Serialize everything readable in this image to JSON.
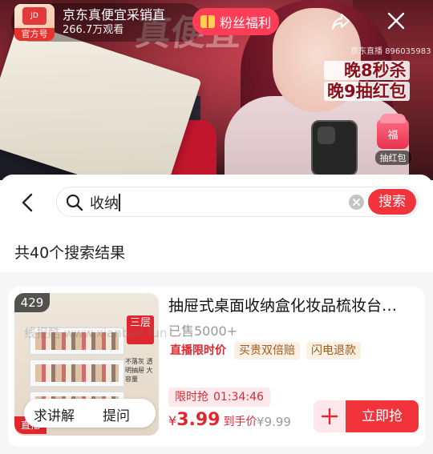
{
  "live": {
    "account_name": "京东真便宜采销直",
    "official_label": "官方号",
    "viewers": "266.7万观看",
    "fans_button": "粉丝福利",
    "room_id": "京东直播 896035983",
    "promo_line1": "晚8秒杀",
    "promo_line2": "晚9抽红包",
    "redpack_char": "福",
    "redpack_label": "抽红包",
    "banner": "真便宜"
  },
  "search": {
    "query": "收纳",
    "button": "搜索"
  },
  "results": {
    "count_text": "共40个搜索结果"
  },
  "product": {
    "rank": "429",
    "title": "抽屉式桌面收纳盒化妆品梳妆台…",
    "sold": "已售5000+",
    "chips": [
      "直播限时价",
      "买贵双倍赔",
      "闪电退款"
    ],
    "timer_label": "限时抢",
    "timer_value": "01:34:46",
    "price_currency": "¥",
    "price_value": "3.99",
    "price_suffix": "到手价",
    "original_price": "¥9.99",
    "image_tag": "三层",
    "image_caption": "不落灰 透明抽屉 大容量",
    "watermark": "线报酷 www.xianbao.fun",
    "live_tag": "直播",
    "ask_explain": "求讲解",
    "ask_question": "提问",
    "buy_button": "立即抢"
  },
  "colors": {
    "accent": "#f2333c",
    "timer_bg": "#fde9ec",
    "chip_gold_bg": "#fbf0e2"
  },
  "icons": [
    "share-icon",
    "close-icon",
    "back-icon",
    "search-icon",
    "clear-icon",
    "plus-icon",
    "gift-icon"
  ]
}
